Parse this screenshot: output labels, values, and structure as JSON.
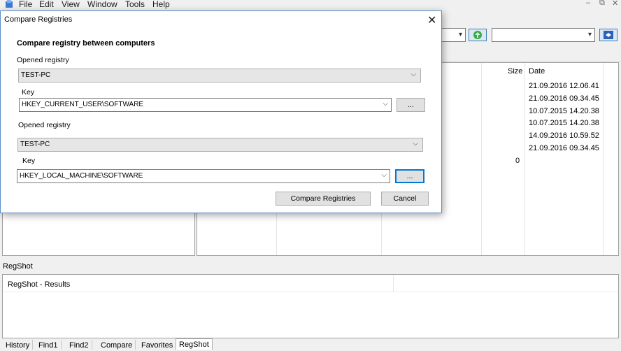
{
  "menu": {
    "items": [
      "File",
      "Edit",
      "View",
      "Window",
      "Tools",
      "Help"
    ]
  },
  "window_controls": {
    "minimize": "–",
    "restore": "⧉",
    "close": "✕"
  },
  "list_columns": {
    "size": "Size",
    "date": "Date"
  },
  "list_rows": [
    {
      "size": "",
      "date": "21.09.2016 12.06.41"
    },
    {
      "size": "",
      "date": "21.09.2016 09.34.45"
    },
    {
      "size": "",
      "date": "10.07.2015 14.20.38"
    },
    {
      "size": "",
      "date": "10.07.2015 14.20.38"
    },
    {
      "size": "",
      "date": "14.09.2016 10.59.52"
    },
    {
      "size": "",
      "date": "21.09.2016 09.34.45"
    },
    {
      "size": "0",
      "date": ""
    }
  ],
  "status_label": "RegShot",
  "results_text": "RegShot - Results",
  "tabs": [
    "History",
    "Find1",
    "Find2",
    "Compare",
    "Favorites",
    "RegShot"
  ],
  "active_tab": "RegShot",
  "dialog": {
    "title": "Compare Registries",
    "close_glyph": "✕",
    "heading": "Compare registry between computers",
    "first": {
      "opened_label": "Opened registry",
      "computer": "TEST-PC",
      "key_label": "Key",
      "key_value": "HKEY_CURRENT_USER\\SOFTWARE",
      "browse": "..."
    },
    "second": {
      "opened_label": "Opened registry",
      "computer": "TEST-PC",
      "key_label": "Key",
      "key_value": "HKEY_LOCAL_MACHINE\\SOFTWARE",
      "browse": "..."
    },
    "compare_button": "Compare Registries",
    "cancel_button": "Cancel"
  }
}
